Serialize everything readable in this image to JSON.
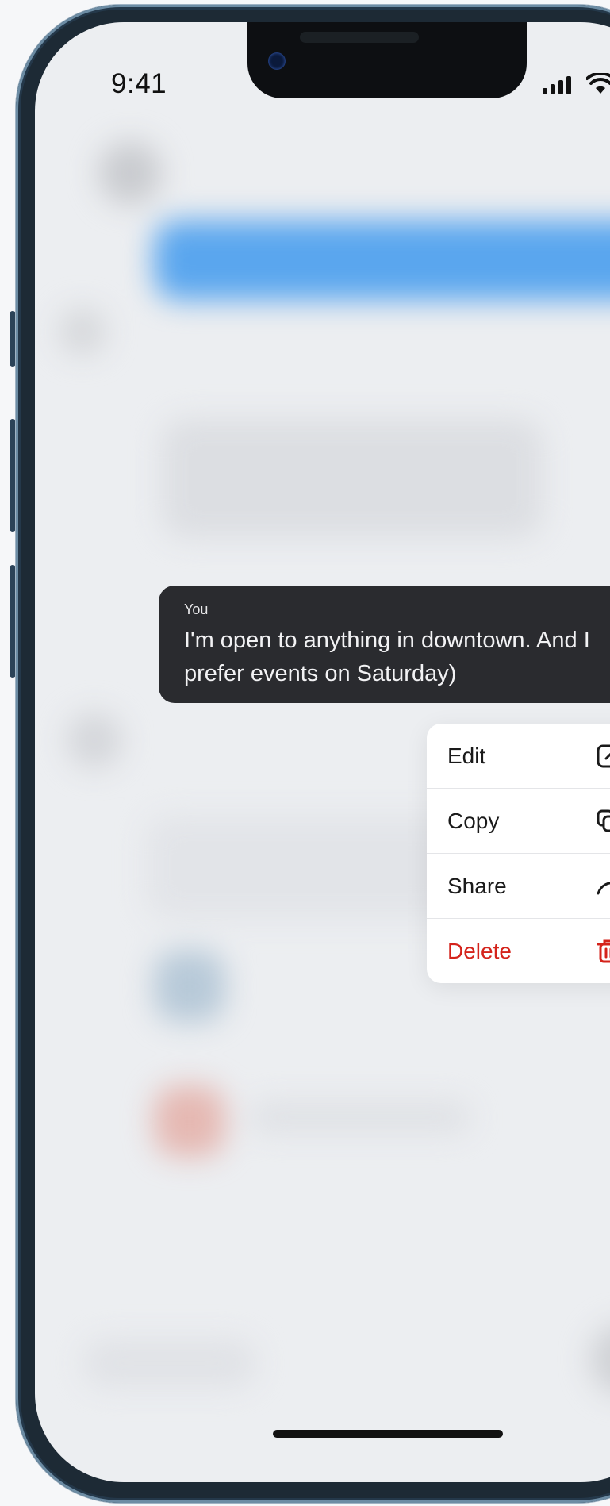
{
  "status_bar": {
    "time": "9:41"
  },
  "message": {
    "sender": "You",
    "text": "I'm open to anything in downtown. And I\nprefer events on Saturday)"
  },
  "context_menu": {
    "items": [
      {
        "label": "Edit",
        "icon": "edit-icon",
        "color": "#1a1a1a"
      },
      {
        "label": "Copy",
        "icon": "copy-icon",
        "color": "#1a1a1a"
      },
      {
        "label": "Share",
        "icon": "share-icon",
        "color": "#1a1a1a"
      },
      {
        "label": "Delete",
        "icon": "trash-icon",
        "color": "#d4231b"
      }
    ]
  },
  "colors": {
    "bubble": "#2a2b2f",
    "danger": "#d4231b",
    "accent_blur": "#5aa6ee"
  }
}
